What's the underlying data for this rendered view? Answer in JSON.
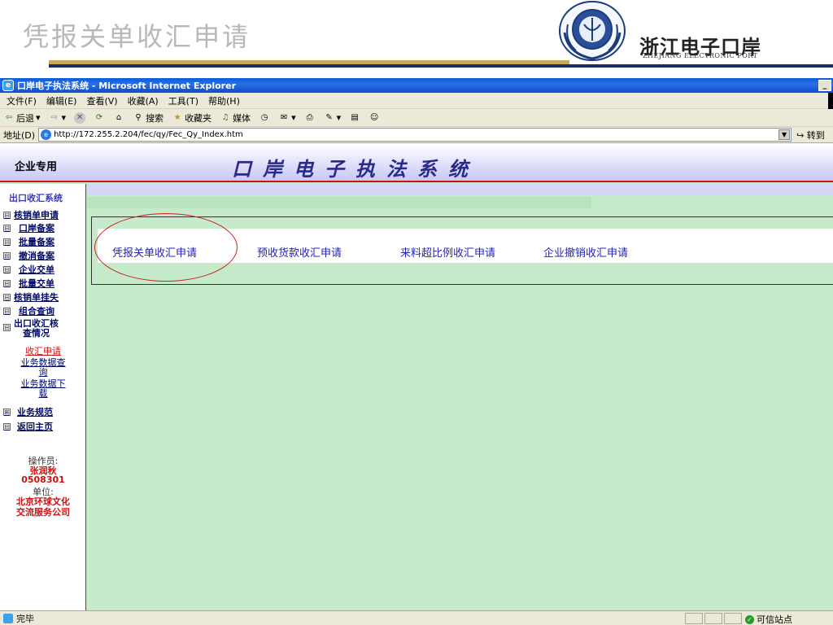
{
  "slide": {
    "title": "凭报关单收汇申请",
    "port_name": "浙江电子口岸",
    "port_name_en": "ZHEJIANG ELECTRONIC PORT"
  },
  "window": {
    "title": "口岸电子执法系统 - Microsoft Internet Explorer",
    "min_glyph": "_"
  },
  "menu": [
    "文件(F)",
    "编辑(E)",
    "查看(V)",
    "收藏(A)",
    "工具(T)",
    "帮助(H)"
  ],
  "toolbar": {
    "back": "后退",
    "search": "搜索",
    "favorites": "收藏夹",
    "media": "媒体"
  },
  "address": {
    "label": "地址(D)",
    "url": "http://172.255.2.204/fec/qy/Fec_Qy_Index.htm",
    "go": "转到"
  },
  "header": {
    "corp_label": "企业专用",
    "system_title": "口岸电子执法系统"
  },
  "sidebar": {
    "title": "出口收汇系统",
    "items": [
      {
        "label": "核销单申请",
        "box": "⊟"
      },
      {
        "label": "口岸备案",
        "box": "⊟"
      },
      {
        "label": "批量备案",
        "box": "⊟"
      },
      {
        "label": "撤消备案",
        "box": "⊟"
      },
      {
        "label": "企业交单",
        "box": "⊟"
      },
      {
        "label": "批量交单",
        "box": "⊟"
      },
      {
        "label": "核销单挂失",
        "box": "⊟"
      },
      {
        "label": "组合查询",
        "box": "⊟"
      }
    ],
    "group": {
      "label_line1": "出口收汇核",
      "label_line2": "查情况",
      "box": "⊟"
    },
    "subitems": [
      "收汇申请",
      "业务数据查询",
      "业务数据下载"
    ],
    "items2": [
      {
        "label": "业务规范",
        "box": "⊞"
      },
      {
        "label": "返回主页",
        "box": "⊟"
      }
    ],
    "operator_label": "操作员:",
    "operator_name": "张润秋",
    "operator_id": "0508301",
    "unit_label": "单位:",
    "unit_name_line1": "北京环球文化",
    "unit_name_line2": "交流服务公司"
  },
  "apps": [
    "凭报关单收汇申请",
    "预收货款收汇申请",
    "来料超比例收汇申请",
    "企业撤销收汇申请"
  ],
  "status": {
    "left": "完毕",
    "zone": "可信站点"
  },
  "colors": {
    "link": "#2424b4",
    "background": "#c6ebcb",
    "highlight_circle": "#cc2020"
  }
}
